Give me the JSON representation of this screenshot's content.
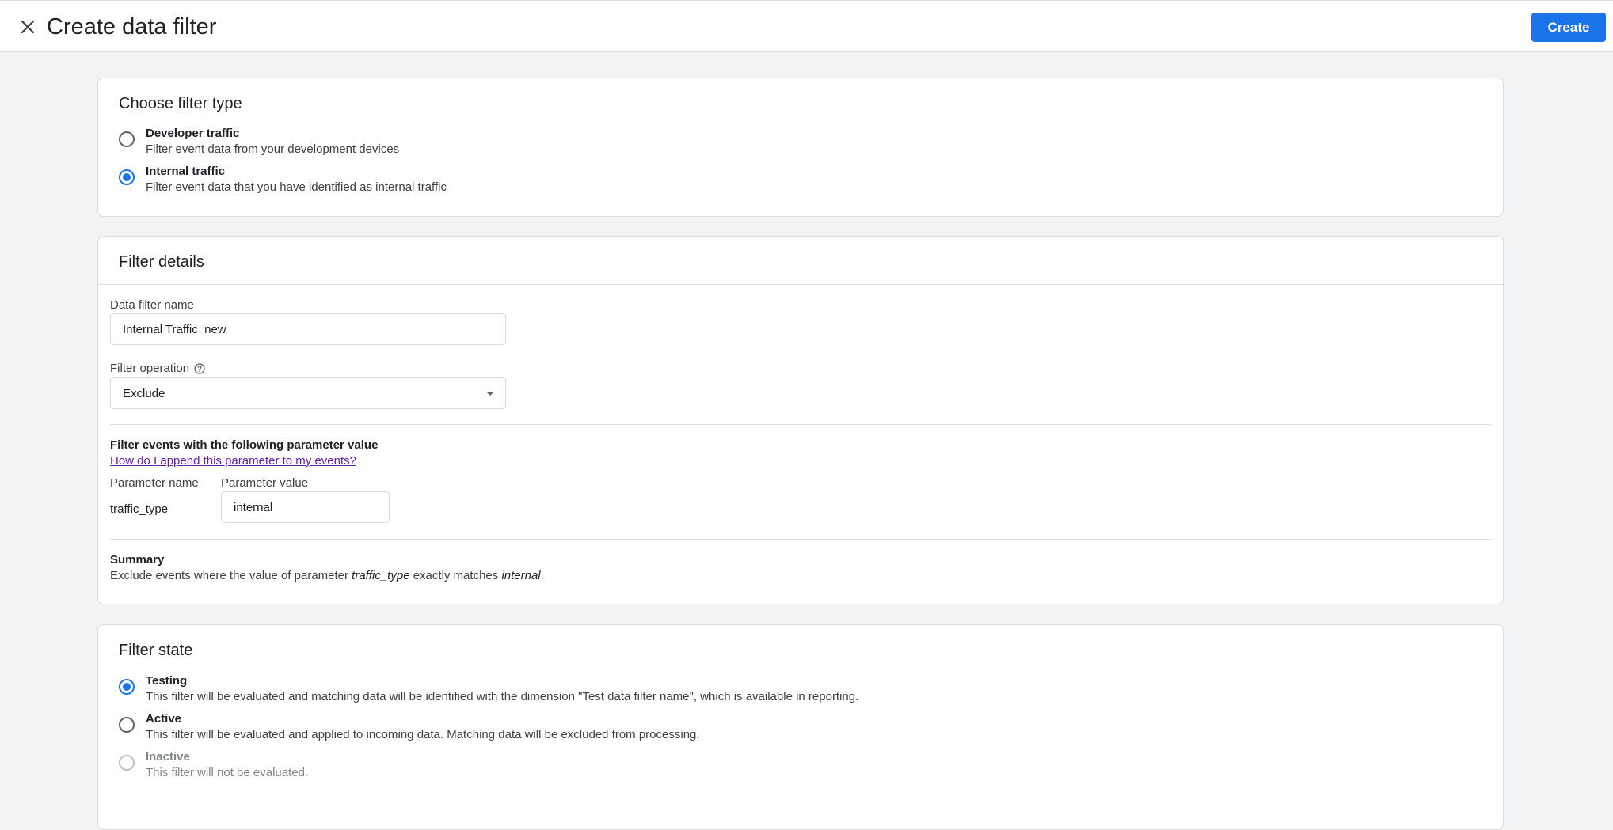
{
  "header": {
    "title": "Create data filter",
    "create_label": "Create"
  },
  "filter_type": {
    "title": "Choose filter type",
    "options": [
      {
        "label": "Developer traffic",
        "description": "Filter event data from your development devices",
        "selected": false
      },
      {
        "label": "Internal traffic",
        "description": "Filter event data that you have identified as internal traffic",
        "selected": true
      }
    ]
  },
  "filter_details": {
    "title": "Filter details",
    "name_label": "Data filter name",
    "name_value": "Internal Traffic_new",
    "operation_label": "Filter operation",
    "operation_value": "Exclude",
    "param_heading": "Filter events with the following parameter value",
    "help_link": "How do I append this parameter to my events?",
    "param_name_label": "Parameter name",
    "param_value_label": "Parameter value",
    "param_name": "traffic_type",
    "param_value": "internal",
    "summary_heading": "Summary",
    "summary_prefix": "Exclude events where the value of parameter ",
    "summary_param": "traffic_type",
    "summary_middle": " exactly matches ",
    "summary_value": "internal",
    "summary_suffix": "."
  },
  "filter_state": {
    "title": "Filter state",
    "options": [
      {
        "label": "Testing",
        "description": "This filter will be evaluated and matching data will be identified with the dimension \"Test data filter name\", which is available in reporting.",
        "selected": true,
        "disabled": false
      },
      {
        "label": "Active",
        "description": "This filter will be evaluated and applied to incoming data. Matching data will be excluded from processing.",
        "selected": false,
        "disabled": false
      },
      {
        "label": "Inactive",
        "description": "This filter will not be evaluated.",
        "selected": false,
        "disabled": true
      }
    ]
  },
  "colors": {
    "accent": "#1a73e8",
    "link_visited": "#681da8",
    "background": "#f1f3f4"
  }
}
